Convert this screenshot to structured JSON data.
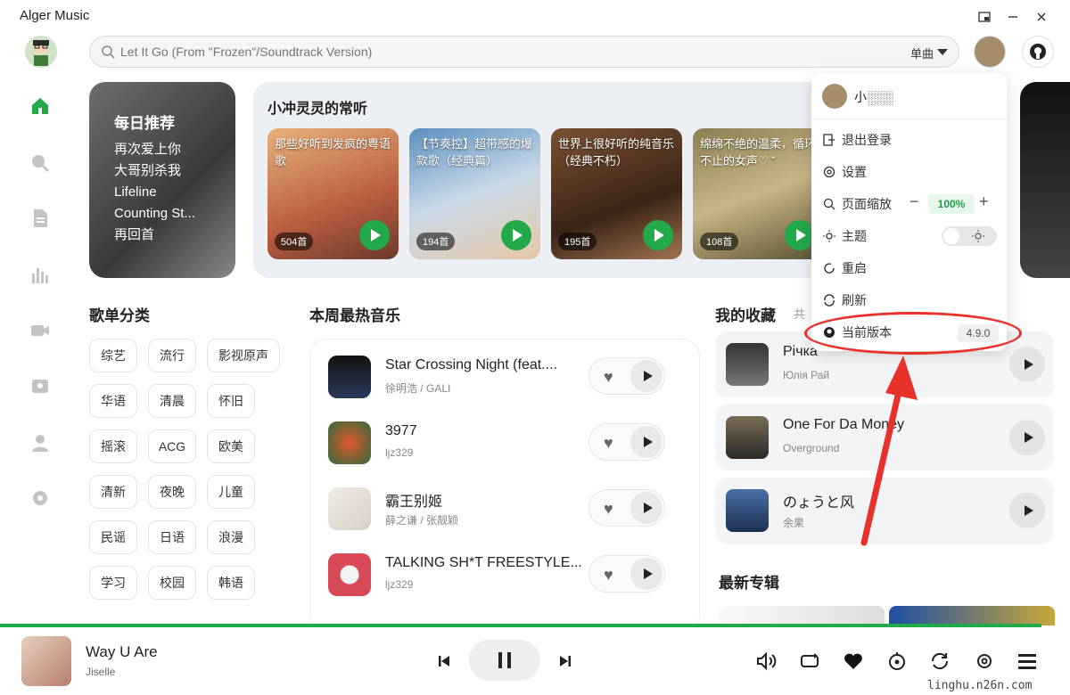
{
  "app": {
    "title": "Alger Music"
  },
  "search": {
    "placeholder": "Let It Go (From \"Frozen\"/Soundtrack Version)",
    "type": "单曲"
  },
  "daily": {
    "title": "每日推荐",
    "songs": [
      "再次爱上你",
      "大哥别杀我",
      "Lifeline",
      "Counting St...",
      "再回首"
    ]
  },
  "favorites": {
    "title": "小冲灵灵的常听",
    "playlists": [
      {
        "name": "那些好听到发疯的粤语歌",
        "count": "504首"
      },
      {
        "name": "【节奏控】超带感的爆款歌（经典篇）",
        "count": "194首"
      },
      {
        "name": "世界上很好听的纯音乐（经典不朽）",
        "count": "195首"
      },
      {
        "name": "绵绵不绝的温柔，循环不止的女声♡ ˘",
        "count": "108首"
      }
    ]
  },
  "sections": {
    "categories": "歌单分类",
    "hot": "本周最热音乐",
    "collection": "我的收藏",
    "collection_suffix": "共",
    "albums": "最新专辑"
  },
  "categories": [
    "综艺",
    "流行",
    "影视原声",
    "华语",
    "清晨",
    "怀旧",
    "摇滚",
    "ACG",
    "欧美",
    "清新",
    "夜晚",
    "儿童",
    "民谣",
    "日语",
    "浪漫",
    "学习",
    "校园",
    "韩语"
  ],
  "hot_songs": [
    {
      "title": "Star Crossing Night (feat....",
      "artist": "徐明浩 / GALI"
    },
    {
      "title": "3977",
      "artist": "ljz329"
    },
    {
      "title": "霸王别姬",
      "artist": "薛之谦 / 张靓颖"
    },
    {
      "title": "TALKING SH*T FREESTYLE...",
      "artist": "ljz329"
    }
  ],
  "collection": [
    {
      "title": "Річка",
      "artist": "Юлія Рай"
    },
    {
      "title": "One For Da Money",
      "artist": "Overground"
    },
    {
      "title": "のょうと风",
      "artist": "余果"
    }
  ],
  "menu": {
    "username": "小░░░",
    "logout": "退出登录",
    "settings": "设置",
    "zoom_label": "页面缩放",
    "zoom_value": "100%",
    "theme": "主题",
    "restart": "重启",
    "refresh": "刷新",
    "version_label": "当前版本",
    "version": "4.9.0"
  },
  "player": {
    "title": "Way U Are",
    "artist": "Jiselle",
    "progress": 0.973
  },
  "watermark": "linghu.n26n.com",
  "colors": {
    "accent": "#22a94a",
    "annotation": "#e8312a"
  }
}
